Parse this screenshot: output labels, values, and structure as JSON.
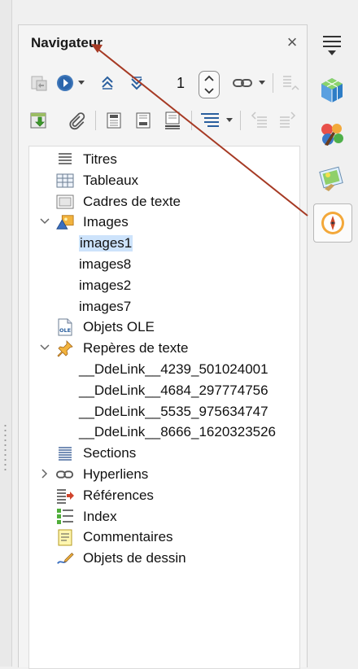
{
  "navigator": {
    "title": "Navigateur",
    "close_symbol": "×",
    "page_number": "1"
  },
  "tree": [
    {
      "label": "Titres",
      "icon": "headings-icon",
      "level": 0
    },
    {
      "label": "Tableaux",
      "icon": "table-icon",
      "level": 0
    },
    {
      "label": "Cadres de texte",
      "icon": "frame-icon",
      "level": 0
    },
    {
      "label": "Images",
      "icon": "images-icon",
      "level": 0,
      "expanded": true
    },
    {
      "label": "images1",
      "level": 1,
      "selected": true
    },
    {
      "label": "images8",
      "level": 1
    },
    {
      "label": "images2",
      "level": 1
    },
    {
      "label": "images7",
      "level": 1
    },
    {
      "label": "Objets OLE",
      "icon": "ole-icon",
      "level": 0
    },
    {
      "label": "Repères de texte",
      "icon": "bookmark-pin-icon",
      "level": 0,
      "expanded": true
    },
    {
      "label": "__DdeLink__4239_501024001",
      "level": 1
    },
    {
      "label": "__DdeLink__4684_297774756",
      "level": 1
    },
    {
      "label": "__DdeLink__5535_975634747",
      "level": 1
    },
    {
      "label": "__DdeLink__8666_1620323526",
      "level": 1
    },
    {
      "label": "Sections",
      "icon": "sections-icon",
      "level": 0
    },
    {
      "label": "Hyperliens",
      "icon": "link-icon",
      "level": 0,
      "collapsed": true
    },
    {
      "label": "Références",
      "icon": "references-icon",
      "level": 0
    },
    {
      "label": "Index",
      "icon": "index-icon",
      "level": 0
    },
    {
      "label": "Commentaires",
      "icon": "comment-icon",
      "level": 0
    },
    {
      "label": "Objets de dessin",
      "icon": "drawing-icon",
      "level": 0
    }
  ],
  "colors": {
    "selection": "#cde3fb",
    "arrow": "#a63a24"
  }
}
